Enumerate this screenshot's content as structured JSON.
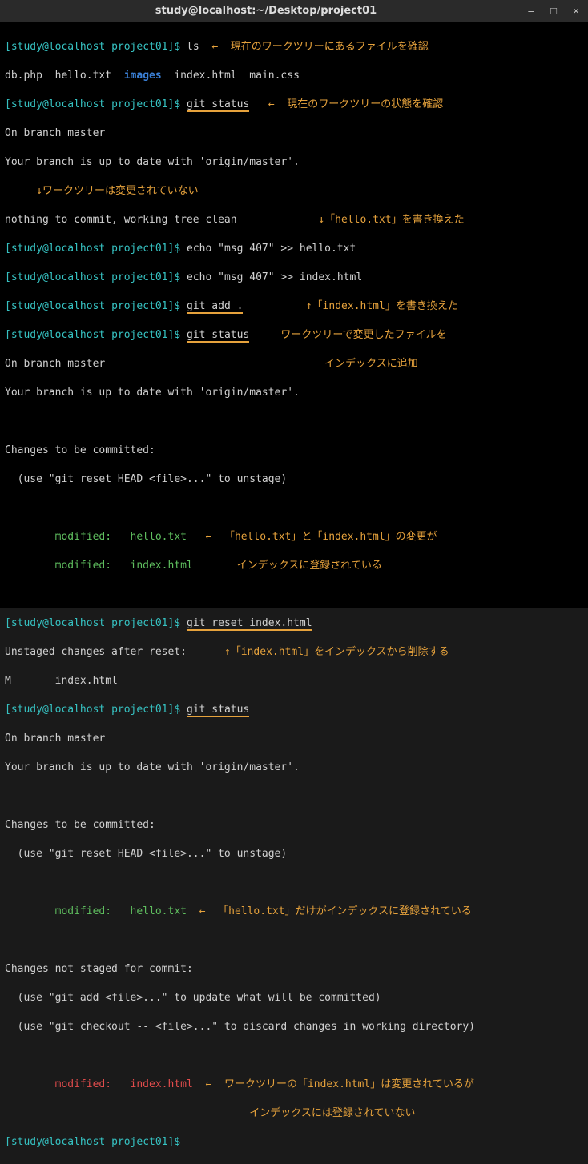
{
  "titlebar": {
    "title": "study@localhost:~/Desktop/project01"
  },
  "prompt": {
    "open": "[",
    "user": "study@localhost",
    "sep": " ",
    "path": "project01",
    "close": "]",
    "sym": "$"
  },
  "cmd": {
    "ls": "ls",
    "git_status": "git status",
    "echo_hello": "echo \"msg 407\" >> hello.txt",
    "echo_index": "echo \"msg 407\" >> index.html",
    "git_add": "git add .",
    "git_reset": "git reset index.html"
  },
  "files": {
    "db": "db.php",
    "hello": "hello.txt",
    "images": "images",
    "index": "index.html",
    "main": "main.css"
  },
  "out": {
    "on_branch": "On branch master",
    "up_to_date": "Your branch is up to date with 'origin/master'.",
    "nothing_commit": "nothing to commit, working tree clean",
    "changes_committed": "Changes to be committed:",
    "use_reset": "  (use \"git reset HEAD <file>...\" to unstage)",
    "mod_hello": "        modified:   hello.txt",
    "mod_index": "        modified:   index.html",
    "unstaged_after": "Unstaged changes after reset:",
    "m_index": "M       index.html",
    "changes_not_staged": "Changes not staged for commit:",
    "use_add": "  (use \"git add <file>...\" to update what will be committed)",
    "use_checkout": "  (use \"git checkout -- <file>...\" to discard changes in working directory)"
  },
  "anno": {
    "a1": "←  現在のワークツリーにあるファイルを確認",
    "a2": "←  現在のワークツリーの状態を確認",
    "a3": "↓ワークツリーは変更されていない",
    "a4": "↓「hello.txt」を書き換えた",
    "a5": "↑「index.html」を書き換えた",
    "a6a": "ワークツリーで変更したファイルを",
    "a6b": "インデックスに追加",
    "a7a": "←  「hello.txt」と「index.html」の変更が",
    "a7b": "インデックスに登録されている",
    "a8": "↑「index.html」をインデックスから削除する",
    "a9": "←  「hello.txt」だけがインデックスに登録されている",
    "a10a": "←  ワークツリーの「index.html」は変更されているが",
    "a10b": "インデックスには登録されていない"
  }
}
